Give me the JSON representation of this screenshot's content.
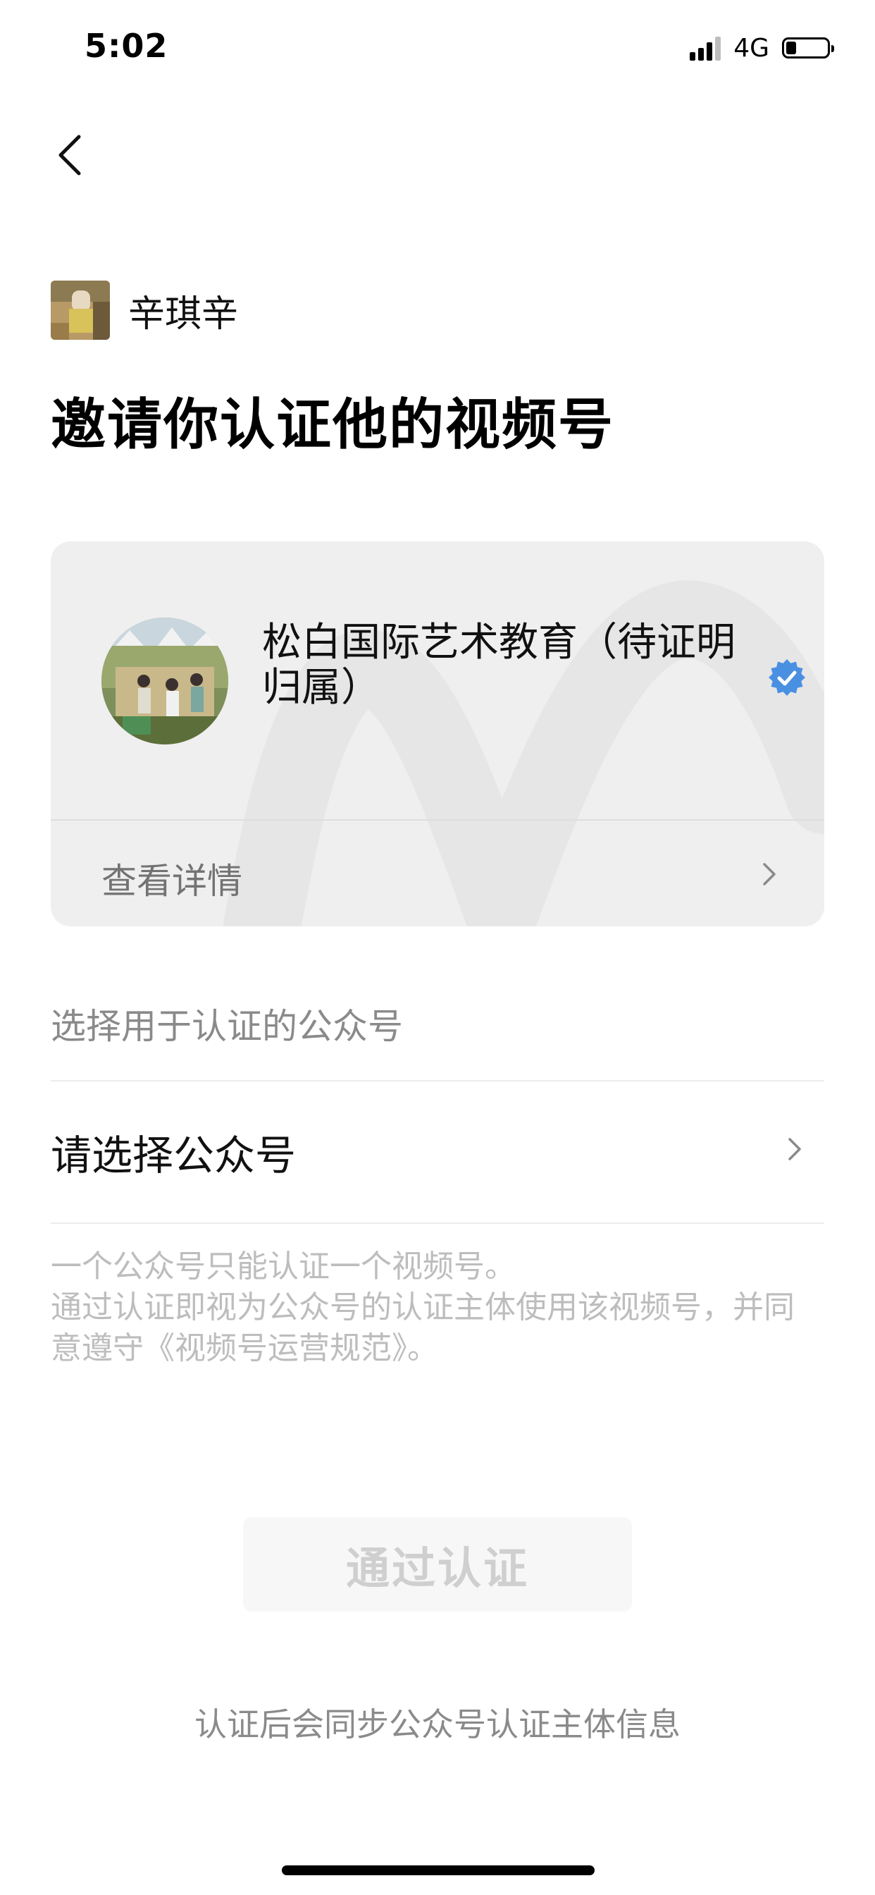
{
  "status_bar": {
    "time": "5:02",
    "network": "4G",
    "signal_bars_active": 3,
    "signal_bars_total": 4,
    "battery_level": 0.25
  },
  "nav": {
    "back_icon": "chevron-left-icon"
  },
  "inviter": {
    "name": "辛琪辛"
  },
  "title": "邀请你认证他的视频号",
  "channel_card": {
    "name": "松白国际艺术教育（待证明归属）",
    "verified_icon": "verified-badge-icon",
    "verified_color": "#4a90e2",
    "details_label": "查看详情",
    "details_icon": "chevron-right-icon"
  },
  "select_section": {
    "label": "选择用于认证的公众号",
    "row_label": "请选择公众号",
    "row_icon": "chevron-right-icon"
  },
  "notice": {
    "line1": "一个公众号只能认证一个视频号。",
    "line2": "通过认证即视为公众号的认证主体使用该视频号，并同意遵守《视频号运营规范》。"
  },
  "submit_button": {
    "label": "通过认证",
    "enabled": false
  },
  "footer_note": "认证后会同步公众号认证主体信息"
}
